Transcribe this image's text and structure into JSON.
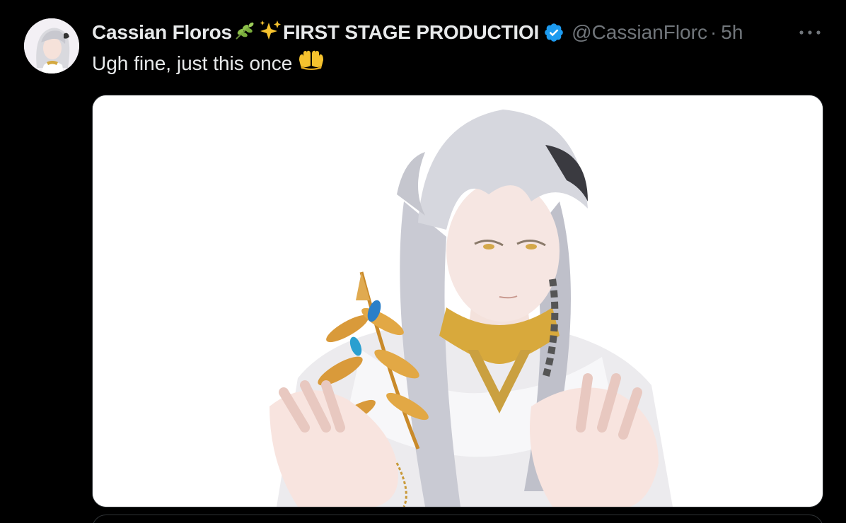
{
  "tweet": {
    "display_name": "Cassian Floros",
    "display_name_suffix": "FIRST STAGE PRODUCTIOI",
    "name_emojis": [
      "herb-icon",
      "sparkles-icon"
    ],
    "handle": "@CassianFlorc",
    "separator": "·",
    "timestamp": "5h",
    "text": "Ugh fine, just this once",
    "text_emoji": "palms-up-together-icon",
    "media_alt": "illustration of a silver-haired elf with clasped hands and a golden laurel branch"
  },
  "colors": {
    "background": "#000000",
    "primary_text": "#e7e9ea",
    "secondary_text": "#71767b",
    "verified": "#1d9bf0",
    "border": "#2f3336"
  }
}
